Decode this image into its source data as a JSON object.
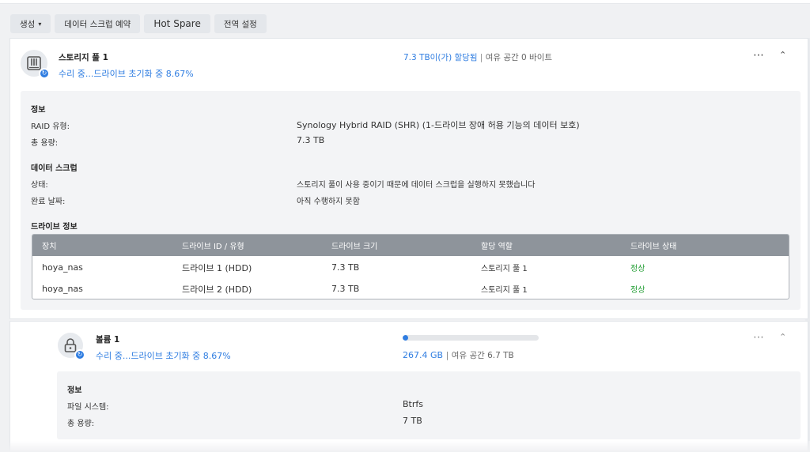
{
  "toolbar": {
    "create": "생성",
    "scrub_schedule": "데이터 스크럽 예약",
    "hot_spare": "Hot Spare",
    "global_settings": "전역 설정"
  },
  "pool": {
    "title": "스토리지 풀 1",
    "status": "수리 중...드라이브 초기화 중 8.67%",
    "allocated": "7.3 TB이(가) 할당됨",
    "separator": "|",
    "free": "여유 공간 0 바이트",
    "info_header": "정보",
    "raid_label": "RAID 유형:",
    "raid_value": "Synology Hybrid RAID (SHR) (1-드라이브 장애 허용 기능의 데이터 보호)",
    "capacity_label": "총 용량:",
    "capacity_value": "7.3 TB",
    "scrub_header": "데이터 스크럽",
    "state_label": "상태:",
    "state_value": "스토리지 풀이 사용 중이기 때문에 데이터 스크럽을 실행하지 못했습니다",
    "complete_label": "완료 날짜:",
    "complete_value": "아직 수행하지 못함",
    "drive_header": "드라이브 정보"
  },
  "drive_table": {
    "columns": [
      "장치",
      "드라이브 ID / 유형",
      "드라이브 크기",
      "할당 역할",
      "드라이브 상태"
    ],
    "rows": [
      [
        "hoya_nas",
        "드라이브 1 (HDD)",
        "7.3 TB",
        "스토리지 풀 1",
        "정상"
      ],
      [
        "hoya_nas",
        "드라이브 2 (HDD)",
        "7.3 TB",
        "스토리지 풀 1",
        "정상"
      ]
    ]
  },
  "volume": {
    "title": "볼륨 1",
    "status": "수리 중...드라이브 초기화 중 8.67%",
    "used": "267.4 GB",
    "separator": "|",
    "free": "여유 공간 6.7 TB",
    "usage_fraction": 0.04,
    "info_header": "정보",
    "fs_label": "파일 시스템:",
    "fs_value": "Btrfs",
    "capacity_label": "총 용량:",
    "capacity_value": "7 TB"
  },
  "icons": {
    "more": "⋯",
    "collapse": "⌃",
    "caret": "▾"
  },
  "colors": {
    "accent": "#2f7de1",
    "healthy": "#27a038",
    "table_header": "#8e949b"
  }
}
